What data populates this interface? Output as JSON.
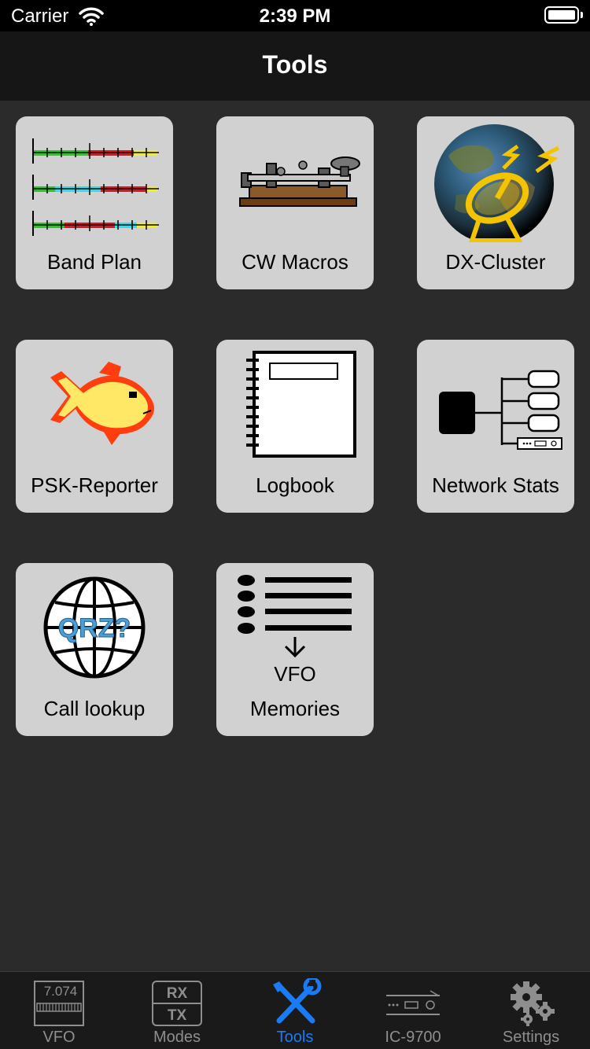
{
  "status": {
    "carrier": "Carrier",
    "time": "2:39 PM"
  },
  "nav": {
    "title": "Tools"
  },
  "tiles": [
    {
      "label": "Band Plan",
      "icon": "band-plan-icon"
    },
    {
      "label": "CW Macros",
      "icon": "morse-key-icon"
    },
    {
      "label": "DX-Cluster",
      "icon": "globe-dish-icon"
    },
    {
      "label": "PSK-Reporter",
      "icon": "fish-icon"
    },
    {
      "label": "Logbook",
      "icon": "notebook-icon"
    },
    {
      "label": "Network Stats",
      "icon": "network-icon"
    },
    {
      "label": "Call lookup",
      "icon": "qrz-globe-icon",
      "icon_text": "QRZ?"
    },
    {
      "label": "Memories",
      "icon": "memory-list-icon",
      "icon_text": "VFO"
    }
  ],
  "tabs": [
    {
      "label": "VFO",
      "icon": "vfo-display-icon",
      "icon_text": "7.074"
    },
    {
      "label": "Modes",
      "icon": "rx-tx-icon",
      "icon_text_top": "RX",
      "icon_text_bottom": "TX"
    },
    {
      "label": "Tools",
      "icon": "tools-icon",
      "active": true
    },
    {
      "label": "IC-9700",
      "icon": "radio-icon"
    },
    {
      "label": "Settings",
      "icon": "gears-icon"
    }
  ],
  "colors": {
    "accent": "#1a7cf5",
    "tile": "#d1d1d1",
    "background": "#2b2b2b",
    "inactive_tab": "#8e8e8e"
  }
}
